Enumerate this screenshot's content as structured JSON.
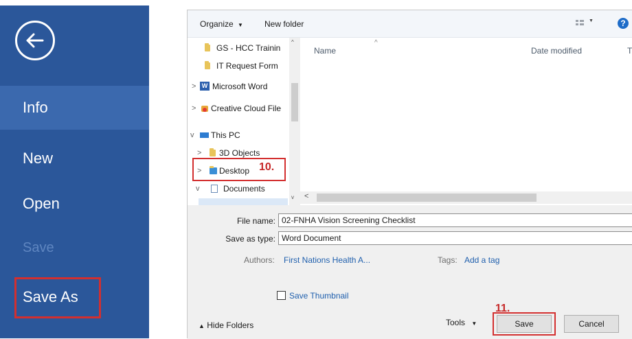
{
  "backstage": {
    "back_icon": "back-arrow-circle-icon",
    "items": [
      {
        "label": "Info",
        "active": true,
        "disabled": false
      },
      {
        "label": "New",
        "active": false,
        "disabled": false
      },
      {
        "label": "Open",
        "active": false,
        "disabled": false
      },
      {
        "label": "Save",
        "active": false,
        "disabled": true
      },
      {
        "label": "Save As",
        "active": false,
        "disabled": false
      }
    ],
    "highlight_color": "#d32f2f",
    "bg_color": "#2b579a"
  },
  "dialog": {
    "toolbar": {
      "organize_label": "Organize",
      "new_folder_label": "New folder",
      "view_icon": "view-options-icon",
      "help_icon": "help-icon"
    },
    "nav_tree": [
      {
        "label": "GS - HCC Trainin",
        "icon": "folder-icon",
        "expander": ""
      },
      {
        "label": "IT Request Form",
        "icon": "folder-icon",
        "expander": ""
      },
      {
        "label": "Microsoft Word",
        "icon": "word-icon",
        "expander": ">"
      },
      {
        "label": "Creative Cloud File",
        "icon": "creative-cloud-icon",
        "expander": ">"
      },
      {
        "label": "This PC",
        "icon": "pc-icon",
        "expander": "v"
      },
      {
        "label": "3D Objects",
        "icon": "folder-icon",
        "expander": ">"
      },
      {
        "label": "Desktop",
        "icon": "desktop-folder-icon",
        "expander": ">"
      },
      {
        "label": "Documents",
        "icon": "documents-icon",
        "expander": "v"
      }
    ],
    "columns": [
      {
        "label": "Name"
      },
      {
        "label": "Date modified"
      },
      {
        "label": "T"
      }
    ],
    "file_name_label": "File name:",
    "file_name_value": "02-FNHA Vision Screening Checklist",
    "save_type_label": "Save as type:",
    "save_type_value": "Word Document",
    "authors_label": "Authors:",
    "authors_value": "First Nations Health A...",
    "tags_label": "Tags:",
    "tags_value": "Add a tag",
    "thumbnail_label": "Save Thumbnail",
    "hide_folders_label": "Hide Folders",
    "tools_label": "Tools",
    "save_label": "Save",
    "cancel_label": "Cancel"
  },
  "annotations": {
    "step10": "10.",
    "step11": "11."
  }
}
